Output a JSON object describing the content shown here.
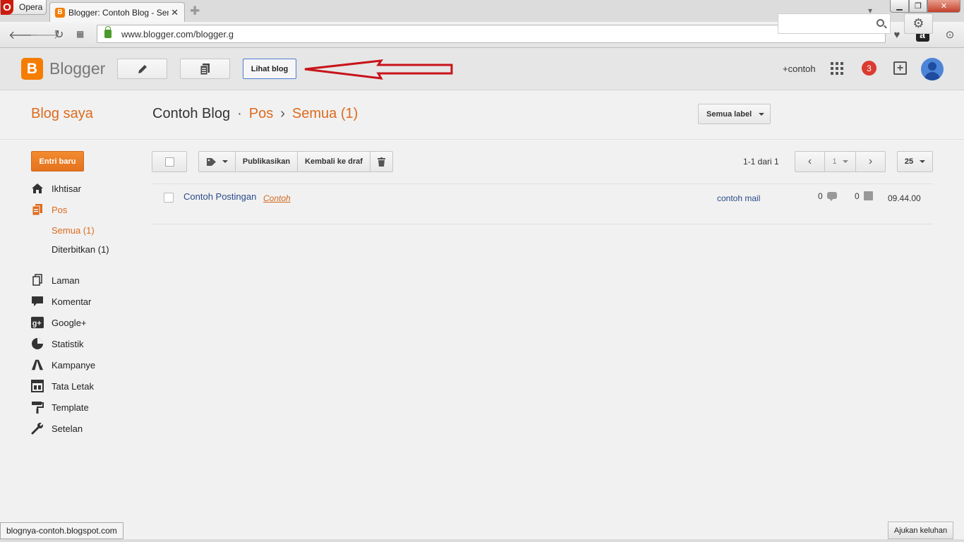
{
  "browser": {
    "menu_label": "Opera",
    "tab_title": "Blogger: Contoh Blog - Semua",
    "url": "www.blogger.com/blogger.g",
    "status_text": "blognya-contoh.blogspot.com"
  },
  "header": {
    "logo_text": "Blogger",
    "view_blog_label": "Lihat blog",
    "user_label": "+contoh",
    "notification_count": "3"
  },
  "titlebar": {
    "my_blogs": "Blog saya",
    "blog_name": "Contoh Blog",
    "section": "Pos",
    "current": "Semua (1)",
    "labels_dropdown": "Semua label",
    "search_value": ""
  },
  "sidebar": {
    "new_post_label": "Entri baru",
    "items": [
      {
        "label": "Ikhtisar",
        "icon": "home-icon"
      },
      {
        "label": "Pos",
        "icon": "posts-icon"
      },
      {
        "label": "Laman",
        "icon": "pages-icon"
      },
      {
        "label": "Komentar",
        "icon": "comments-icon"
      },
      {
        "label": "Google+",
        "icon": "google-plus-icon"
      },
      {
        "label": "Statistik",
        "icon": "stats-icon"
      },
      {
        "label": "Kampanye",
        "icon": "campaign-icon"
      },
      {
        "label": "Tata Letak",
        "icon": "layout-icon"
      },
      {
        "label": "Template",
        "icon": "template-icon"
      },
      {
        "label": "Setelan",
        "icon": "wrench-icon"
      }
    ],
    "sub_items": [
      {
        "label": "Semua (1)"
      },
      {
        "label": "Diterbitkan (1)"
      }
    ]
  },
  "post_toolbar": {
    "publish_label": "Publikasikan",
    "revert_label": "Kembali ke draf",
    "range_text": "1-1 dari 1",
    "page_number": "1",
    "per_page": "25"
  },
  "posts": [
    {
      "title": "Contoh Postingan",
      "label": "Contoh",
      "author": "contoh mail",
      "comments": "0",
      "views": "0",
      "time": "09.44.00"
    }
  ],
  "footer": {
    "feedback_label": "Ajukan keluhan"
  },
  "colors": {
    "accent_orange": "#dd6b1d",
    "annotation_red": "#c8141a",
    "link_blue": "#2a4a8a"
  }
}
